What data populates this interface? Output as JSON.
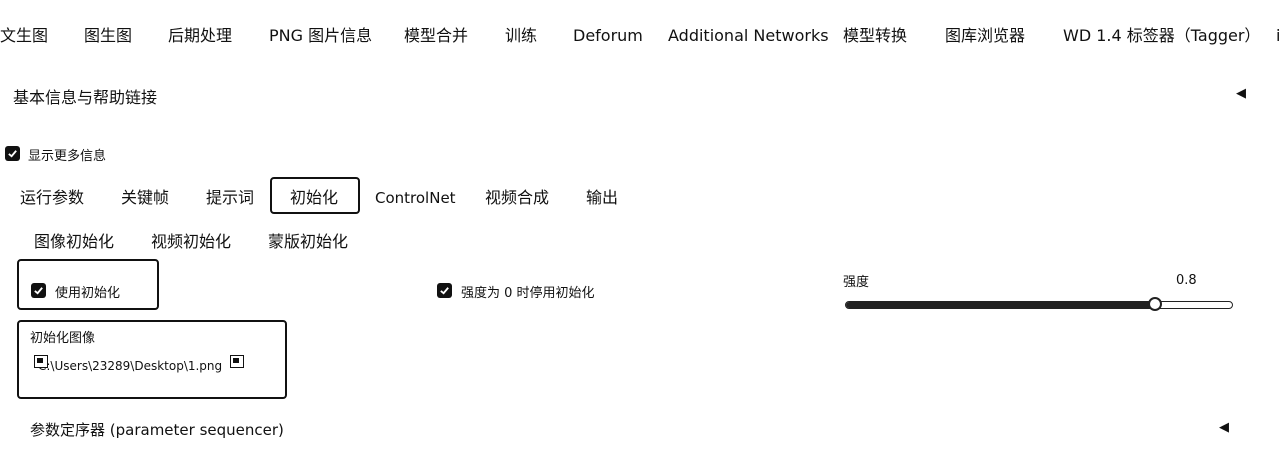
{
  "top_tabs": [
    {
      "label": "文生图"
    },
    {
      "label": "图生图"
    },
    {
      "label": "后期处理"
    },
    {
      "label": "PNG 图片信息"
    },
    {
      "label": "模型合并"
    },
    {
      "label": "训练"
    },
    {
      "label": "Deforum"
    },
    {
      "label": "Additional Networks"
    },
    {
      "label": "模型转换"
    },
    {
      "label": "图库浏览器"
    },
    {
      "label": "WD 1.4 标签器（Tagger）"
    },
    {
      "label": "i"
    }
  ],
  "info_panel": {
    "title": "基本信息与帮助链接",
    "arrow": "◀"
  },
  "show_more": {
    "label": "显示更多信息",
    "checked": true
  },
  "section_tabs": [
    {
      "label": "运行参数"
    },
    {
      "label": "关键帧"
    },
    {
      "label": "提示词"
    },
    {
      "label": "初始化",
      "active": true
    },
    {
      "label": "ControlNet"
    },
    {
      "label": "视频合成"
    },
    {
      "label": "输出"
    }
  ],
  "init_tabs": [
    {
      "label": "图像初始化"
    },
    {
      "label": "视频初始化"
    },
    {
      "label": "蒙版初始化"
    }
  ],
  "use_init": {
    "label": "使用初始化",
    "checked": true
  },
  "strength_zero": {
    "label": "强度为 0 时停用初始化",
    "checked": true
  },
  "strength": {
    "label": "强度",
    "value": "0.8",
    "fraction": 0.8
  },
  "init_image": {
    "label": "初始化图像",
    "value": "C:\\Users\\23289\\Desktop\\1.png",
    "display_text": "C:\\Users\\23289\\Desktop\\1.png"
  },
  "sequencer": {
    "title": "参数定序器 (parameter sequencer)",
    "arrow": "◀"
  }
}
